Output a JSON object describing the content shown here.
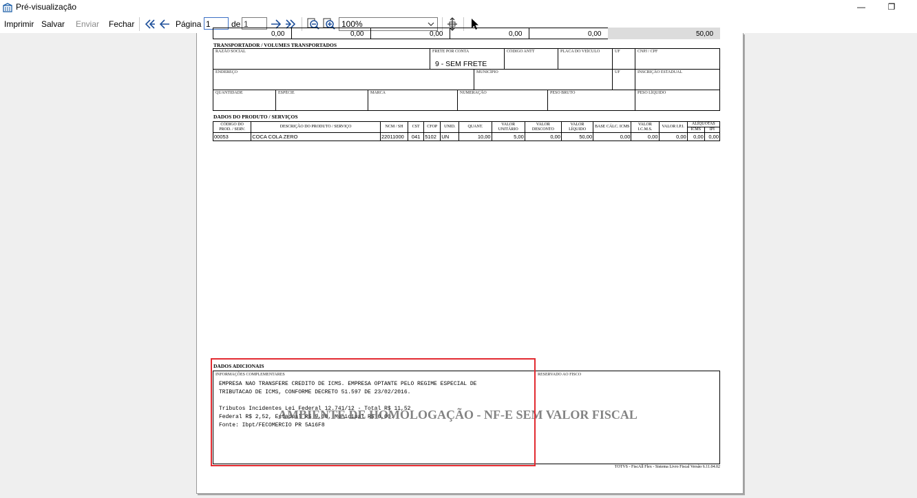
{
  "window": {
    "title": "Pré-visualização",
    "minimize_glyph": "—",
    "restore_glyph": "❐"
  },
  "toolbar": {
    "print_label": "Imprimir",
    "save_label": "Salvar",
    "send_label": "Enviar",
    "close_label": "Fechar",
    "page_label": "Página",
    "page_value": "1",
    "of_label": "de",
    "total_pages": "1",
    "zoom_value": "100%",
    "icons": [
      "first-page-icon",
      "prev-page-icon",
      "next-page-icon",
      "last-page-icon",
      "zoom-out-icon",
      "zoom-in-icon",
      "fit-page-icon",
      "pointer-icon"
    ]
  },
  "document": {
    "top_row_values": [
      "0,00",
      "0,00",
      "0,00",
      "0,00",
      "0,00",
      "50,00"
    ],
    "transport": {
      "title": "TRANSPORTADOR / VOLUMES TRANSPORTADOS",
      "labels": {
        "razao_social": "RAZÃO SOCIAL",
        "frete": "FRETE POR CONTA",
        "antt": "CÓDIGO ANTT",
        "placa": "PLACA DO VEÍCULO",
        "uf1": "UF",
        "cnpj": "CNPJ / CPF",
        "endereco": "ENDEREÇO",
        "municipio": "MUNICÍPIO",
        "uf2": "UF",
        "ie": "INSCRIÇÃO ESTADUAL",
        "quantidade": "QUANTIDADE",
        "especie": "ESPÉCIE",
        "marca": "MARCA",
        "numeracao": "NUMERAÇÃO",
        "peso_bruto": "PESO BRUTO",
        "peso_liquido": "PESO LÍQUIDO"
      },
      "frete_value": "9 - SEM FRETE"
    },
    "products": {
      "title": "DADOS DO PRODUTO / SERVIÇOS",
      "headers": {
        "codigo": "CÓDIGO DO PROD. / SERV.",
        "descricao": "DESCRIÇÃO DO PRODUTO / SERVIÇO",
        "ncm": "NCM / SH",
        "cst": "CST",
        "cfop": "CFOP",
        "unid": "UNID.",
        "quant": "QUANT.",
        "vunit": "VALOR UNITÁRIO",
        "vdesc": "VALOR DESCONTO",
        "vliq": "VALOR LÍQUIDO",
        "base": "BASE CÁLC. ICMS",
        "vicms": "VALOR I.C.M.S.",
        "vipi": "VALOR I.P.I.",
        "aliq": "ALÍQUOTAS",
        "aliq_icms": "ICMS",
        "aliq_ipi": "IPI"
      },
      "rows": [
        {
          "codigo": "00053",
          "descricao": "COCA COLA ZERO",
          "ncm": "22011000",
          "cst": "041",
          "cfop": "5102",
          "unid": "UN",
          "quant": "10,00",
          "vunit": "5,00",
          "vdesc": "0,00",
          "vliq": "50,00",
          "base": "0,00",
          "vicms": "0,00",
          "vipi": "0,00",
          "aliq_icms": "0,00",
          "aliq_ipi": "0,00"
        }
      ]
    },
    "additional": {
      "title": "DADOS ADICIONAIS",
      "info_label": "INFORMAÇÕES COMPLEMENTARES",
      "fisco_label": "RESERVADO AO FISCO",
      "lines": [
        "EMPRESA NAO TRANSFERE CREDITO DE ICMS. EMPRESA OPTANTE PELO REGIME ESPECIAL DE",
        "TRIBUTACAO DE ICMS, CONFORME DECRETO 51.597 DE 23/02/2016.",
        "",
        "Tributos Incidentes Lei Federal 12.741/12 - Total R$ 11,52",
        "Federal R$ 2,52, Estadual R$ 9,00, Municipal R$ 0,00.",
        "Fonte: Ibpt/FECOMERCIO PR 5A16F8"
      ]
    },
    "watermark": "AMBIENTE DE HOMOLOGAÇÃO - NF-E SEM VALOR FISCAL",
    "footer": "TOTVS - FiscAll Flex - Sistema Livro Fiscal Versão 6.11.04.02"
  }
}
